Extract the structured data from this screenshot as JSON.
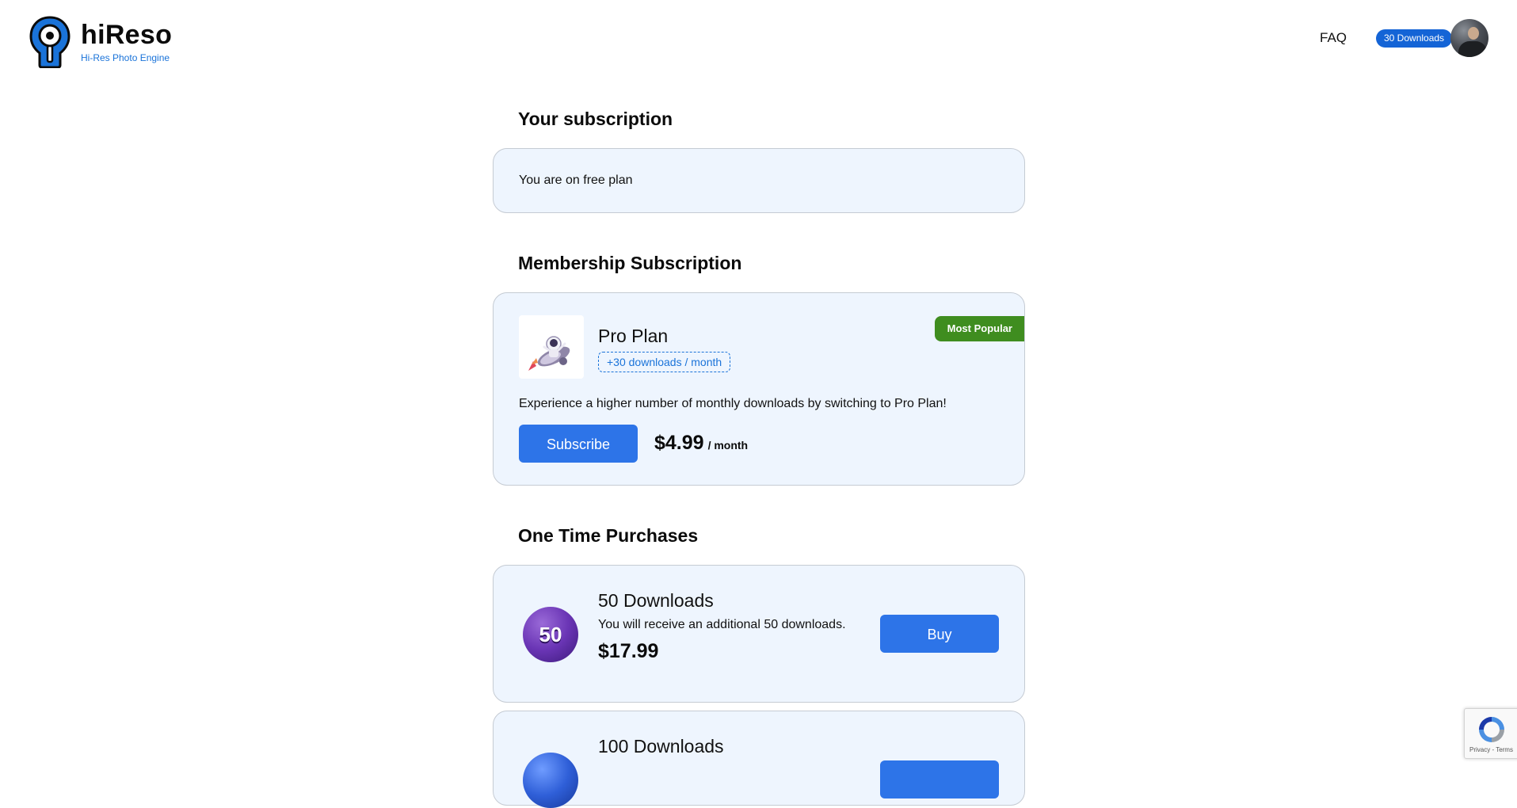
{
  "header": {
    "brand_name": "hiReso",
    "brand_tagline": "Hi-Res Photo Engine",
    "nav_faq": "FAQ",
    "downloads_pill": "30 Downloads"
  },
  "subscription": {
    "title": "Your subscription",
    "status_text": "You are on free plan"
  },
  "membership": {
    "title": "Membership Subscription",
    "plan_name": "Pro Plan",
    "plan_badge": "+30 downloads / month",
    "popular_label": "Most Popular",
    "description": "Experience a higher number of monthly downloads by switching to Pro Plan!",
    "subscribe_label": "Subscribe",
    "price": "$4.99",
    "period": "/ month"
  },
  "one_time": {
    "title": "One Time Purchases",
    "packages": [
      {
        "coin_label": "50",
        "name": "50 Downloads",
        "description": "You will receive an additional 50 downloads.",
        "price": "$17.99",
        "buy_label": "Buy"
      },
      {
        "name": "100 Downloads"
      }
    ]
  },
  "recaptcha": {
    "links": "Privacy - Terms"
  },
  "colors": {
    "accent": "#2d74e8",
    "brand_blue": "#1a73d9",
    "popular_green": "#3f8d1f",
    "card_bg": "#eef5fe"
  }
}
